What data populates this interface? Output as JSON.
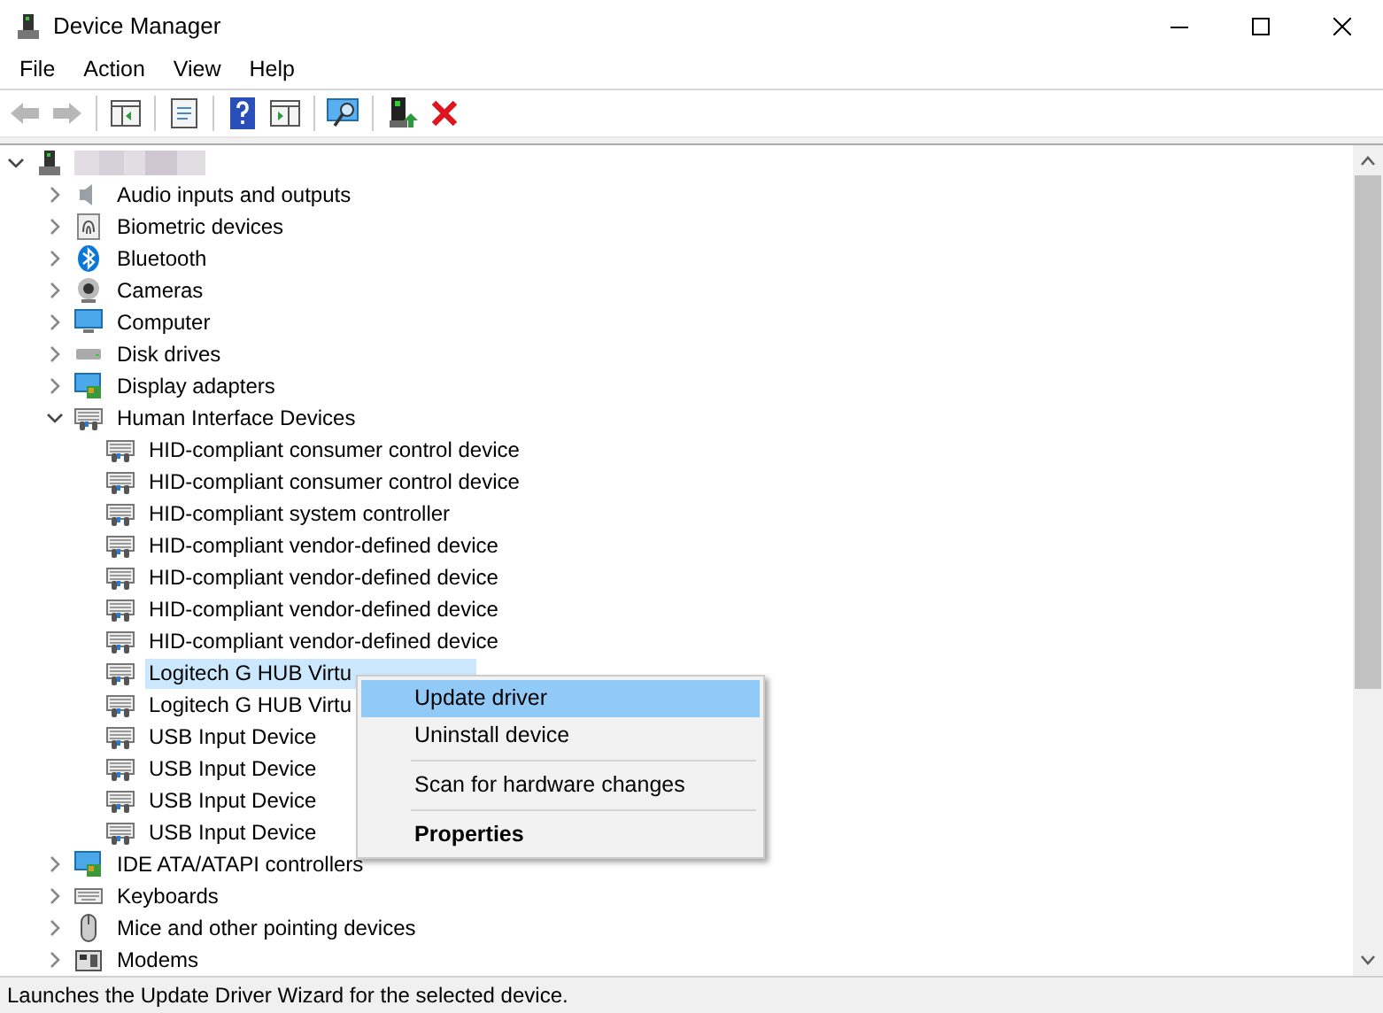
{
  "window": {
    "title": "Device Manager"
  },
  "menu": [
    "File",
    "Action",
    "View",
    "Help"
  ],
  "toolbar": [
    {
      "kind": "back",
      "disabled": true
    },
    {
      "kind": "forward",
      "disabled": true
    },
    {
      "kind": "console",
      "disabled": false
    },
    {
      "kind": "properties",
      "disabled": false
    },
    {
      "kind": "help",
      "disabled": false
    },
    {
      "kind": "action",
      "disabled": false
    },
    {
      "kind": "scan",
      "disabled": false
    },
    {
      "kind": "update",
      "disabled": false
    },
    {
      "kind": "remove",
      "disabled": false
    }
  ],
  "tree": {
    "expanded": true,
    "children": [
      {
        "label": "Audio inputs and outputs",
        "kind": "audio",
        "expanded": false,
        "selected": false
      },
      {
        "label": "Biometric devices",
        "kind": "biometric",
        "expanded": false,
        "selected": false
      },
      {
        "label": "Bluetooth",
        "kind": "bluetooth",
        "expanded": false,
        "selected": false
      },
      {
        "label": "Cameras",
        "kind": "camera",
        "expanded": false,
        "selected": false
      },
      {
        "label": "Computer",
        "kind": "monitor",
        "expanded": false,
        "selected": false
      },
      {
        "label": "Disk drives",
        "kind": "disk",
        "expanded": false,
        "selected": false
      },
      {
        "label": "Display adapters",
        "kind": "display",
        "expanded": false,
        "selected": false
      },
      {
        "label": "Human Interface Devices",
        "kind": "hid",
        "expanded": true,
        "selected": false,
        "children": [
          {
            "label": "HID-compliant consumer control device",
            "kind": "hid",
            "selected": false
          },
          {
            "label": "HID-compliant consumer control device",
            "kind": "hid",
            "selected": false
          },
          {
            "label": "HID-compliant system controller",
            "kind": "hid",
            "selected": false
          },
          {
            "label": "HID-compliant vendor-defined device",
            "kind": "hid",
            "selected": false
          },
          {
            "label": "HID-compliant vendor-defined device",
            "kind": "hid",
            "selected": false
          },
          {
            "label": "HID-compliant vendor-defined device",
            "kind": "hid",
            "selected": false
          },
          {
            "label": "HID-compliant vendor-defined device",
            "kind": "hid",
            "selected": false
          },
          {
            "label": "Logitech G HUB Virtu",
            "kind": "hid",
            "selected": true
          },
          {
            "label": "Logitech G HUB Virtu",
            "kind": "hid",
            "selected": false
          },
          {
            "label": "USB Input Device",
            "kind": "hid",
            "selected": false
          },
          {
            "label": "USB Input Device",
            "kind": "hid",
            "selected": false
          },
          {
            "label": "USB Input Device",
            "kind": "hid",
            "selected": false
          },
          {
            "label": "USB Input Device",
            "kind": "hid",
            "selected": false
          }
        ]
      },
      {
        "label": "IDE ATA/ATAPI controllers",
        "kind": "display",
        "expanded": false,
        "selected": false
      },
      {
        "label": "Keyboards",
        "kind": "keyboard",
        "expanded": false,
        "selected": false
      },
      {
        "label": "Mice and other pointing devices",
        "kind": "mouse",
        "expanded": false,
        "selected": false
      },
      {
        "label": "Modems",
        "kind": "modem",
        "expanded": false,
        "selected": false
      }
    ]
  },
  "context_menu": [
    {
      "label": "Update driver",
      "selected": true,
      "bold": false,
      "separator_before": false
    },
    {
      "label": "Uninstall device",
      "selected": false,
      "bold": false,
      "separator_before": false
    },
    {
      "label": "Scan for hardware changes",
      "selected": false,
      "bold": false,
      "separator_before": true
    },
    {
      "label": "Properties",
      "selected": false,
      "bold": true,
      "separator_before": true
    }
  ],
  "status_bar": "Launches the Update Driver Wizard for the selected device."
}
